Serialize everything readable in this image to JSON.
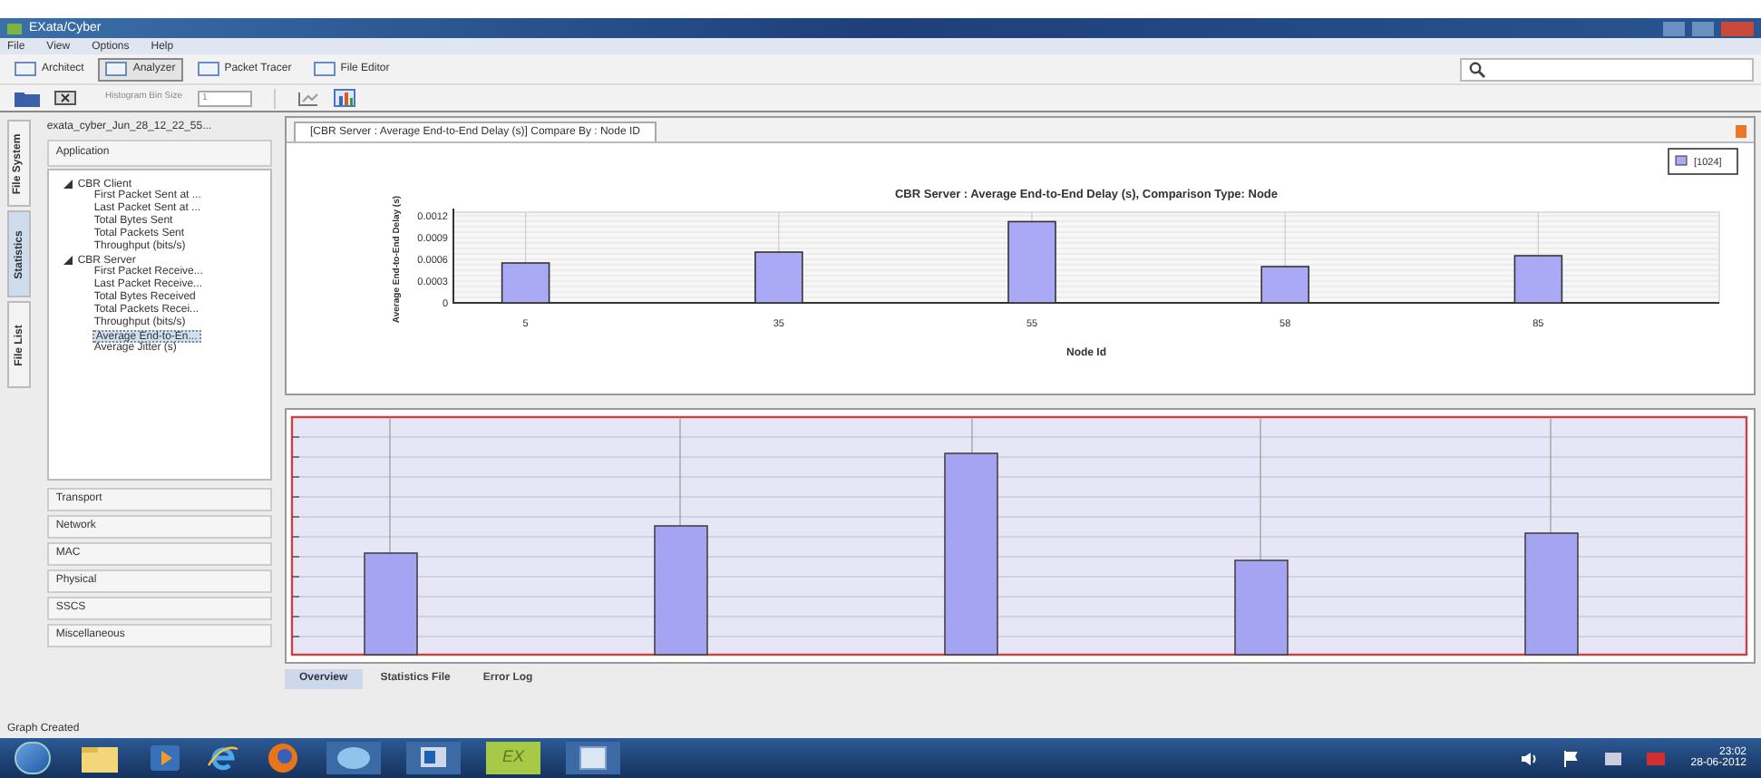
{
  "window": {
    "title": "EXata/Cyber"
  },
  "menu": [
    "File",
    "View",
    "Options",
    "Help"
  ],
  "modes": [
    {
      "label": "Architect",
      "selected": false
    },
    {
      "label": "Analyzer",
      "selected": true
    },
    {
      "label": "Packet Tracer",
      "selected": false
    },
    {
      "label": "File Editor",
      "selected": false
    }
  ],
  "toolbar": {
    "bin_size_label": "Histogram Bin Size",
    "bin_size_value": "1"
  },
  "sidebar": {
    "vertical_tabs": [
      {
        "label": "File System",
        "selected": false
      },
      {
        "label": "Statistics",
        "selected": true
      },
      {
        "label": "File List",
        "selected": false
      }
    ],
    "file": "exata_cyber_Jun_28_12_22_55...",
    "open_section": "Application",
    "tree": [
      {
        "label": "CBR Client",
        "expanded": true,
        "children": [
          {
            "label": "First Packet Sent at ...",
            "selected": false
          },
          {
            "label": "Last Packet Sent at ...",
            "selected": false
          },
          {
            "label": "Total Bytes Sent",
            "selected": false
          },
          {
            "label": "Total Packets Sent",
            "selected": false
          },
          {
            "label": "Throughput (bits/s)",
            "selected": false
          }
        ]
      },
      {
        "label": "CBR Server",
        "expanded": true,
        "children": [
          {
            "label": "First Packet Receive...",
            "selected": false
          },
          {
            "label": "Last Packet Receive...",
            "selected": false
          },
          {
            "label": "Total Bytes Received",
            "selected": false
          },
          {
            "label": "Total Packets Recei...",
            "selected": false
          },
          {
            "label": "Throughput (bits/s)",
            "selected": false
          },
          {
            "label": "Average End-to-En...",
            "selected": true
          },
          {
            "label": "Average Jitter (s)",
            "selected": false
          }
        ]
      }
    ],
    "sections": [
      "Transport",
      "Network",
      "MAC",
      "Physical",
      "SSCS",
      "Miscellaneous"
    ]
  },
  "graph_tab": "[CBR Server : Average End-to-End Delay (s)] Compare By : Node ID",
  "chart": {
    "chart_data": {
      "type": "bar",
      "title": "CBR Server :  Average End-to-End Delay (s), Comparison Type: Node",
      "xlabel": "Node Id",
      "ylabel": "Average End-to-End Delay (s)",
      "categories": [
        "5",
        "35",
        "55",
        "58",
        "85"
      ],
      "series": [
        {
          "name": "[1024]",
          "color": "#a9a9f5",
          "values": [
            0.00055,
            0.0007,
            0.00112,
            0.0005,
            0.00065
          ]
        }
      ],
      "ylim": [
        0,
        0.0012
      ],
      "grid": true,
      "yticks": [
        {
          "value": 0,
          "label": "0"
        },
        {
          "value": 0.0003,
          "label": "0.0003"
        },
        {
          "value": 0.0006,
          "label": "0.0006"
        },
        {
          "value": 0.0009,
          "label": "0.0009"
        },
        {
          "value": 0.0012,
          "label": "0.0012"
        }
      ]
    }
  },
  "bottom_tabs": [
    {
      "label": "Overview",
      "selected": true
    },
    {
      "label": "Statistics File",
      "selected": false
    },
    {
      "label": "Error Log",
      "selected": false
    }
  ],
  "status_bar": "Graph Created",
  "taskbar": {
    "app_label": "EX",
    "time": "23:02",
    "date": "28-06-2012"
  }
}
